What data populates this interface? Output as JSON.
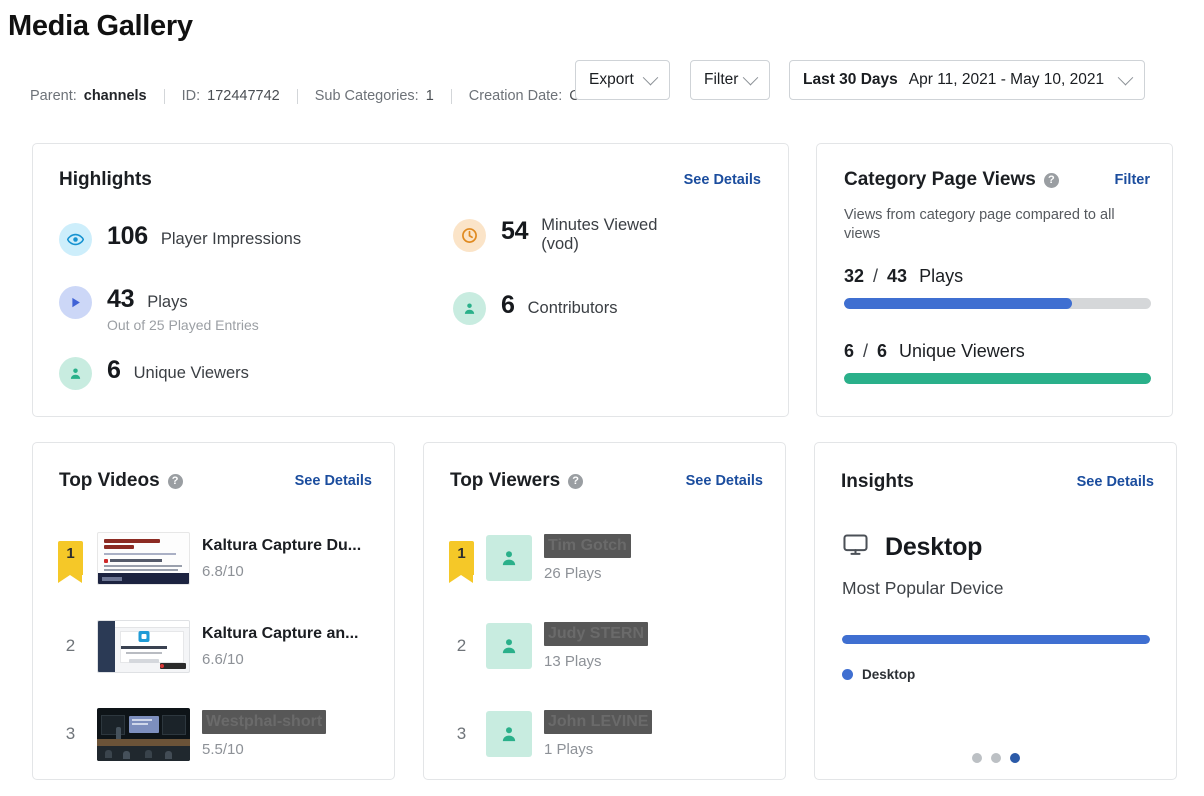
{
  "header": {
    "title": "Media Gallery"
  },
  "meta": {
    "parent_label": "Parent:",
    "parent_value": "channels",
    "id_label": "ID:",
    "id_value": "172447742",
    "subcat_label": "Sub Categories:",
    "subcat_value": "1",
    "creation_label": "Creation Date:",
    "creation_value": "C"
  },
  "controls": {
    "export_label": "Export",
    "filter_label": "Filter",
    "date_preset": "Last 30 Days",
    "date_range": "Apr 11, 2021 - May 10, 2021",
    "chevron_icon": "chevron-down-icon"
  },
  "highlights": {
    "title": "Highlights",
    "see_details": "See Details",
    "items": [
      {
        "icon": "eye-icon",
        "value": "106",
        "label": "Player Impressions",
        "sub": ""
      },
      {
        "icon": "clock-icon",
        "value": "54",
        "label": "Minutes Viewed (vod)",
        "label_line1": "Minutes Viewed",
        "label_line2": "(vod)",
        "sub": ""
      },
      {
        "icon": "play-icon",
        "value": "43",
        "label": "Plays",
        "sub": "Out of 25 Played Entries"
      },
      {
        "icon": "person-icon",
        "value": "6",
        "label": "Contributors",
        "sub": ""
      },
      {
        "icon": "person-icon",
        "value": "6",
        "label": "Unique Viewers",
        "sub": ""
      }
    ]
  },
  "category_page_views": {
    "title": "Category Page Views",
    "help_icon": "help-icon",
    "filter_link": "Filter",
    "description": "Views from category page compared to all views",
    "metrics": [
      {
        "numerator": "32",
        "slash": "/",
        "denominator": "43",
        "name": "Plays",
        "percent": 74.4,
        "color": "#3f6fd1"
      },
      {
        "numerator": "6",
        "slash": "/",
        "denominator": "6",
        "name": "Unique Viewers",
        "percent": 100,
        "color": "#2ab08a"
      }
    ]
  },
  "top_videos": {
    "title": "Top Videos",
    "help_icon": "help-icon",
    "see_details": "See Details",
    "rows": [
      {
        "rank": "1",
        "title": "Kaltura Capture Du...",
        "redacted": false,
        "score": "6.8/10",
        "thumb": "slide-thumbnail"
      },
      {
        "rank": "2",
        "title": "Kaltura Capture an...",
        "redacted": false,
        "score": "6.6/10",
        "thumb": "app-screenshot-thumbnail"
      },
      {
        "rank": "3",
        "title": "Westphal-short",
        "redacted": true,
        "score": "5.5/10",
        "thumb": "lecture-hall-thumbnail"
      }
    ]
  },
  "top_viewers": {
    "title": "Top Viewers",
    "help_icon": "help-icon",
    "see_details": "See Details",
    "rows": [
      {
        "rank": "1",
        "name": "Tim Gotch",
        "redacted": true,
        "plays": "26 Plays",
        "avatar": "person-avatar"
      },
      {
        "rank": "2",
        "name": "Judy STERN",
        "redacted": true,
        "plays": "13 Plays",
        "avatar": "person-avatar"
      },
      {
        "rank": "3",
        "name": "John LEVINE",
        "redacted": true,
        "plays": "1 Plays",
        "avatar": "person-avatar"
      }
    ]
  },
  "insights": {
    "title": "Insights",
    "see_details": "See Details",
    "device_icon": "desktop-monitor-icon",
    "device": "Desktop",
    "subtitle": "Most Popular Device",
    "bar_percent": 100,
    "bar_color": "#3f6fd1",
    "legend": [
      {
        "label": "Desktop",
        "color": "#3f6fd1"
      }
    ],
    "carousel": {
      "count": 3,
      "active_index": 2
    }
  },
  "colors": {
    "link": "#1b4d9e",
    "blue": "#3f6fd1",
    "green": "#2ab08a",
    "yellow": "#f5c828",
    "track": "#d5d7d9"
  }
}
